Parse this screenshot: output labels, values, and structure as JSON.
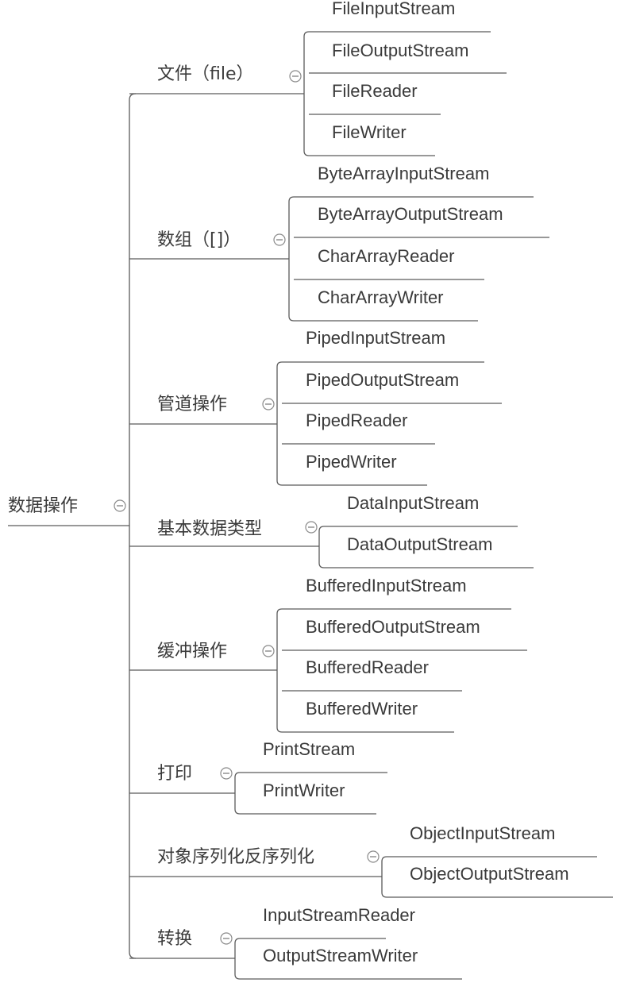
{
  "root": {
    "label": "数据操作"
  },
  "branches": [
    {
      "label": "文件（file）",
      "children": [
        "FileInputStream",
        "FileOutputStream",
        "FileReader",
        "FileWriter"
      ]
    },
    {
      "label": "数组（[]）",
      "children": [
        "ByteArrayInputStream",
        "ByteArrayOutputStream",
        "CharArrayReader",
        "CharArrayWriter"
      ]
    },
    {
      "label": "管道操作",
      "children": [
        "PipedInputStream",
        "PipedOutputStream",
        "PipedReader",
        "PipedWriter"
      ]
    },
    {
      "label": "基本数据类型",
      "children": [
        "DataInputStream",
        "DataOutputStream"
      ]
    },
    {
      "label": "缓冲操作",
      "children": [
        "BufferedInputStream",
        "BufferedOutputStream",
        "BufferedReader",
        "BufferedWriter"
      ]
    },
    {
      "label": "打印",
      "children": [
        "PrintStream",
        "PrintWriter"
      ]
    },
    {
      "label": "对象序列化反序列化",
      "children": [
        "ObjectInputStream",
        "ObjectOutputStream"
      ]
    },
    {
      "label": "转换",
      "children": [
        "InputStreamReader",
        "OutputStreamWriter"
      ]
    }
  ],
  "collapse_icon": "minus-circle-icon"
}
